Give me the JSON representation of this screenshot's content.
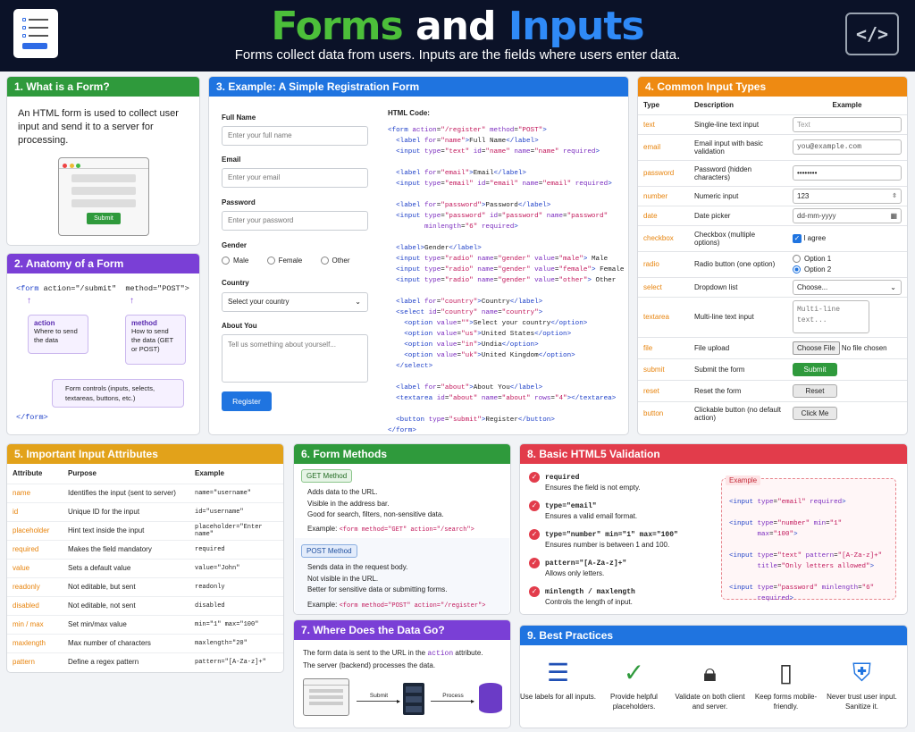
{
  "header": {
    "title_a": "Forms",
    "title_b": "and",
    "title_c": "Inputs",
    "subtitle": "Forms collect data from users. Inputs are the fields where users enter data."
  },
  "s1": {
    "title": "1. What is a Form?",
    "text": "An HTML form is used to collect user input and send it to a server for processing.",
    "submit": "Submit"
  },
  "s2": {
    "title": "2. Anatomy of a Form",
    "open_tag": "<form",
    "action_attr": "action=\"/submit\"",
    "method_attr": "method=\"POST\">",
    "close_tag": "</form>",
    "action_h": "action",
    "action_d": "Where to send the data",
    "method_h": "method",
    "method_d": "How to send the data (GET or POST)",
    "controls": "Form controls (inputs, selects, textareas, buttons, etc.)"
  },
  "s3": {
    "title": "3. Example: A Simple Registration Form",
    "full_name": "Full Name",
    "full_name_ph": "Enter your full name",
    "email": "Email",
    "email_ph": "Enter your email",
    "password": "Password",
    "password_ph": "Enter your password",
    "gender": "Gender",
    "male": "Male",
    "female": "Female",
    "other": "Other",
    "country": "Country",
    "country_sel": "Select your country",
    "about": "About You",
    "about_ph": "Tell us something about yourself...",
    "register": "Register",
    "code_title": "HTML Code:"
  },
  "s4": {
    "title": "4. Common Input Types",
    "headers": [
      "Type",
      "Description",
      "Example"
    ],
    "rows": [
      {
        "type": "text",
        "desc": "Single-line text input",
        "ex": "Text"
      },
      {
        "type": "email",
        "desc": "Email input with basic validation",
        "ex": "you@example.com"
      },
      {
        "type": "password",
        "desc": "Password (hidden characters)",
        "ex": "••••••••"
      },
      {
        "type": "number",
        "desc": "Numeric input",
        "ex": "123"
      },
      {
        "type": "date",
        "desc": "Date picker",
        "ex": "dd-mm-yyyy"
      },
      {
        "type": "checkbox",
        "desc": "Checkbox (multiple options)",
        "ex": "I agree"
      },
      {
        "type": "radio",
        "desc": "Radio button (one option)",
        "ex": "Option 1",
        "ex2": "Option 2"
      },
      {
        "type": "select",
        "desc": "Dropdown list",
        "ex": "Choose..."
      },
      {
        "type": "textarea",
        "desc": "Multi-line text input",
        "ex": "Multi-line text..."
      },
      {
        "type": "file",
        "desc": "File upload",
        "ex": "Choose File",
        "ex2": "No file chosen"
      },
      {
        "type": "submit",
        "desc": "Submit the form",
        "ex": "Submit"
      },
      {
        "type": "reset",
        "desc": "Reset the form",
        "ex": "Reset"
      },
      {
        "type": "button",
        "desc": "Clickable button (no default action)",
        "ex": "Click Me"
      }
    ]
  },
  "s5": {
    "title": "5. Important Input Attributes",
    "headers": [
      "Attribute",
      "Purpose",
      "Example"
    ],
    "rows": [
      [
        "name",
        "Identifies the input (sent to server)",
        "name=\"username\""
      ],
      [
        "id",
        "Unique ID for the input",
        "id=\"username\""
      ],
      [
        "placeholder",
        "Hint text inside the input",
        "placeholder=\"Enter name\""
      ],
      [
        "required",
        "Makes the field mandatory",
        "required"
      ],
      [
        "value",
        "Sets a default value",
        "value=\"John\""
      ],
      [
        "readonly",
        "Not editable, but sent",
        "readonly"
      ],
      [
        "disabled",
        "Not editable, not sent",
        "disabled"
      ],
      [
        "min / max",
        "Set min/max value",
        "min=\"1\" max=\"100\""
      ],
      [
        "maxlength",
        "Max number of characters",
        "maxlength=\"20\""
      ],
      [
        "pattern",
        "Define a regex pattern",
        "pattern=\"[A-Za-z]+\""
      ]
    ]
  },
  "s6": {
    "title": "6. Form Methods",
    "get_badge": "GET Method",
    "get_l1": "Adds data to the URL.",
    "get_l2": "Visible in the address bar.",
    "get_l3": "Good for search, filters, non-sensitive data.",
    "get_ex_lbl": "Example:",
    "get_ex": "<form method=\"GET\" action=\"/search\">",
    "post_badge": "POST Method",
    "post_l1": "Sends data in the request body.",
    "post_l2": "Not visible in the URL.",
    "post_l3": "Better for sensitive data or submitting forms.",
    "post_ex_lbl": "Example:",
    "post_ex": "<form method=\"POST\" action=\"/register\">"
  },
  "s7": {
    "title": "7. Where Does the Data Go?",
    "text1": "The form data is sent to the URL in the",
    "text1_code": "action",
    "text1_end": "attribute.",
    "text2": "The server (backend) processes the data.",
    "submit": "Submit",
    "process": "Process"
  },
  "s8": {
    "title": "8. Basic HTML5 Validation",
    "items": [
      {
        "code": "required",
        "desc": "Ensures the field is not empty."
      },
      {
        "code": "type=\"email\"",
        "desc": "Ensures a valid email format."
      },
      {
        "code": "type=\"number\" min=\"1\" max=\"100\"",
        "desc": "Ensures number is between 1 and 100."
      },
      {
        "code": "pattern=\"[A-Za-z]+\"",
        "desc": "Allows only letters."
      },
      {
        "code": "minlength / maxlength",
        "desc": "Controls the length of input."
      }
    ],
    "example_lbl": "Example"
  },
  "s9": {
    "title": "9. Best Practices",
    "items": [
      "Use labels for all inputs.",
      "Provide helpful placeholders.",
      "Validate on both client and server.",
      "Keep forms mobile-friendly.",
      "Never trust user input. Sanitize it."
    ]
  },
  "colors": {
    "green": "#2f9a3c",
    "blue": "#1f74e0",
    "orange": "#ee8a12",
    "purple": "#7a3fd6",
    "gold": "#e2a21a",
    "red": "#e23c4b"
  }
}
